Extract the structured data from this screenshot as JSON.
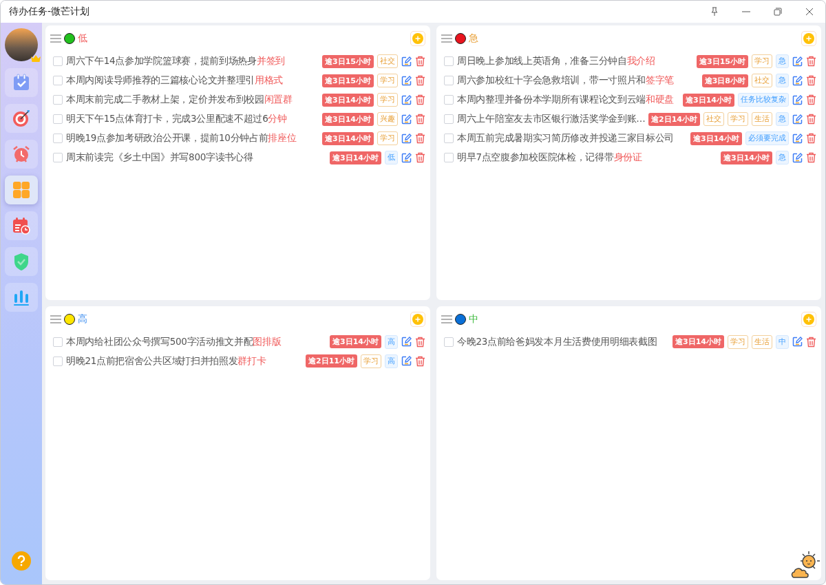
{
  "window": {
    "title": "待办任务-微芒计划"
  },
  "sidebar": {
    "items": [
      {
        "kind": "calendar",
        "selected": false
      },
      {
        "kind": "target",
        "selected": false
      },
      {
        "kind": "alarm",
        "selected": false
      },
      {
        "kind": "quadrant",
        "selected": true
      },
      {
        "kind": "schedule",
        "selected": false
      },
      {
        "kind": "shield",
        "selected": false
      },
      {
        "kind": "stats",
        "selected": false
      }
    ]
  },
  "quadrants": [
    {
      "title": "低",
      "color": "#22c01e",
      "tasks": [
        {
          "checked": false,
          "text": "周六下午14点参加学院篮球赛，提前到场热身",
          "highlight": "并签到",
          "overdue": "逾3日15小时",
          "tags": [
            {
              "kind": "category",
              "label": "社交"
            }
          ]
        },
        {
          "checked": false,
          "text": "本周内阅读导师推荐的三篇核心论文并整理引",
          "highlight": "用格式",
          "overdue": "逾3日15小时",
          "tags": [
            {
              "kind": "category",
              "label": "学习"
            }
          ]
        },
        {
          "checked": false,
          "text": "本周末前完成二手教材上架，定价并发布到校园",
          "highlight": "闲置群",
          "overdue": "逾3日14小时",
          "tags": [
            {
              "kind": "category",
              "label": "学习"
            }
          ]
        },
        {
          "checked": false,
          "text": "明天下午15点体育打卡，完成3公里配速不超过6",
          "highlight": "分钟",
          "overdue": "逾3日14小时",
          "tags": [
            {
              "kind": "category",
              "label": "兴趣"
            }
          ]
        },
        {
          "checked": false,
          "text": "明晚19点参加考研政治公开课，提前10分钟占前",
          "highlight": "排座位",
          "overdue": "逾3日14小时",
          "tags": [
            {
              "kind": "category",
              "label": "学习"
            }
          ]
        },
        {
          "checked": false,
          "text": "周末前读完《乡土中国》并写800字读书心得",
          "overdue": "逾3日14小时",
          "tags": [
            {
              "kind": "priority",
              "label": "低"
            }
          ]
        }
      ]
    },
    {
      "title": "急",
      "color": "#e8141e",
      "tasks": [
        {
          "checked": false,
          "text": "周日晚上参加线上英语角，准备三分钟自",
          "highlight": "我介绍",
          "overdue": "逾3日15小时",
          "tags": [
            {
              "kind": "category",
              "label": "学习"
            },
            {
              "kind": "priority",
              "label": "急"
            }
          ]
        },
        {
          "checked": false,
          "text": "周六参加校红十字会急救培训，带一寸照片和",
          "highlight": "签字笔",
          "overdue": "逾3日8小时",
          "tags": [
            {
              "kind": "category",
              "label": "社交"
            },
            {
              "kind": "priority",
              "label": "急"
            }
          ]
        },
        {
          "checked": false,
          "text": "本周内整理并备份本学期所有课程论文到云端",
          "highlight": "和硬盘",
          "overdue": "逾3日14小时",
          "tags": [
            {
              "kind": "priority",
              "label": "任务比较复杂"
            }
          ]
        },
        {
          "checked": false,
          "text": "周六上午陪室友去市区银行激活奖学金到账…",
          "overdue": "逾2日14小时",
          "tags": [
            {
              "kind": "category",
              "label": "社交"
            },
            {
              "kind": "category",
              "label": "学习"
            },
            {
              "kind": "category",
              "label": "生活"
            },
            {
              "kind": "priority",
              "label": "急"
            }
          ]
        },
        {
          "checked": false,
          "text": "本周五前完成暑期实习简历修改并投递三家目标公司",
          "overdue": "逾3日14小时",
          "tags": [
            {
              "kind": "priority",
              "label": "必须要完成"
            }
          ]
        },
        {
          "checked": false,
          "text": "明早7点空腹参加校医院体检，记得带",
          "highlight": "身份证",
          "overdue": "逾3日14小时",
          "tags": [
            {
              "kind": "priority",
              "label": "急"
            }
          ]
        }
      ]
    },
    {
      "title": "高",
      "color": "#ffe600",
      "tasks": [
        {
          "checked": false,
          "text": "本周内给社团公众号撰写500字活动推文并配",
          "highlight": "图排版",
          "overdue": "逾3日14小时",
          "tags": [
            {
              "kind": "priority",
              "label": "高"
            }
          ]
        },
        {
          "checked": false,
          "text": "明晚21点前把宿舍公共区域打扫并拍照发",
          "highlight": "群打卡",
          "overdue": "逾2日11小时",
          "tags": [
            {
              "kind": "category",
              "label": "学习"
            },
            {
              "kind": "priority",
              "label": "高"
            }
          ]
        }
      ]
    },
    {
      "title": "中",
      "color": "#0a6fd6",
      "tasks": [
        {
          "checked": false,
          "text": "今晚23点前给爸妈发本月生活费使用明细表截图",
          "overdue": "逾3日14小时",
          "tags": [
            {
              "kind": "category",
              "label": "学习"
            },
            {
              "kind": "category",
              "label": "生活"
            },
            {
              "kind": "priority",
              "label": "中"
            }
          ]
        }
      ]
    }
  ]
}
